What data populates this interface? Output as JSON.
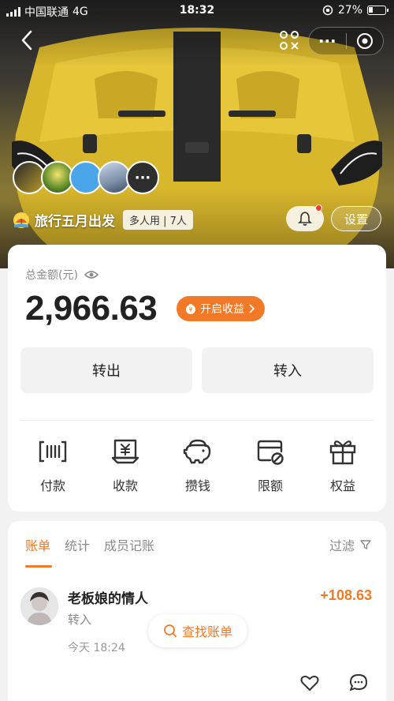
{
  "status_bar": {
    "carrier": "中国联通",
    "network": "4G",
    "time": "18:32",
    "battery_percent": "27%",
    "battery_level": 0.27
  },
  "header": {
    "group_name": "旅行五月出发",
    "group_tag": "多人用 | 7人",
    "settings_label": "设置",
    "more_label": "···",
    "avatar_more_label": "···",
    "notification_dot_color": "#ef3e2e"
  },
  "balance": {
    "label": "总金额(元)",
    "amount": "2,966.63",
    "earn_button_label": "开启收益",
    "transfer_out_label": "转出",
    "transfer_in_label": "转入",
    "accent_color": "#f27a26"
  },
  "shortcuts": [
    {
      "icon": "barcode-pay-icon",
      "label": "付款"
    },
    {
      "icon": "yuan-receipt-icon",
      "label": "收款"
    },
    {
      "icon": "piggy-bank-icon",
      "label": "攒钱"
    },
    {
      "icon": "card-limit-icon",
      "label": "限额"
    },
    {
      "icon": "gift-icon",
      "label": "权益"
    }
  ],
  "bills": {
    "tabs": [
      "账单",
      "统计",
      "成员记账"
    ],
    "active_tab": 0,
    "filter_label": "过滤",
    "find_bill_label": "查找账单",
    "transactions": [
      {
        "name": "老板娘的情人",
        "type": "转入",
        "time": "今天 18:24",
        "amount": "+108.63"
      }
    ]
  }
}
